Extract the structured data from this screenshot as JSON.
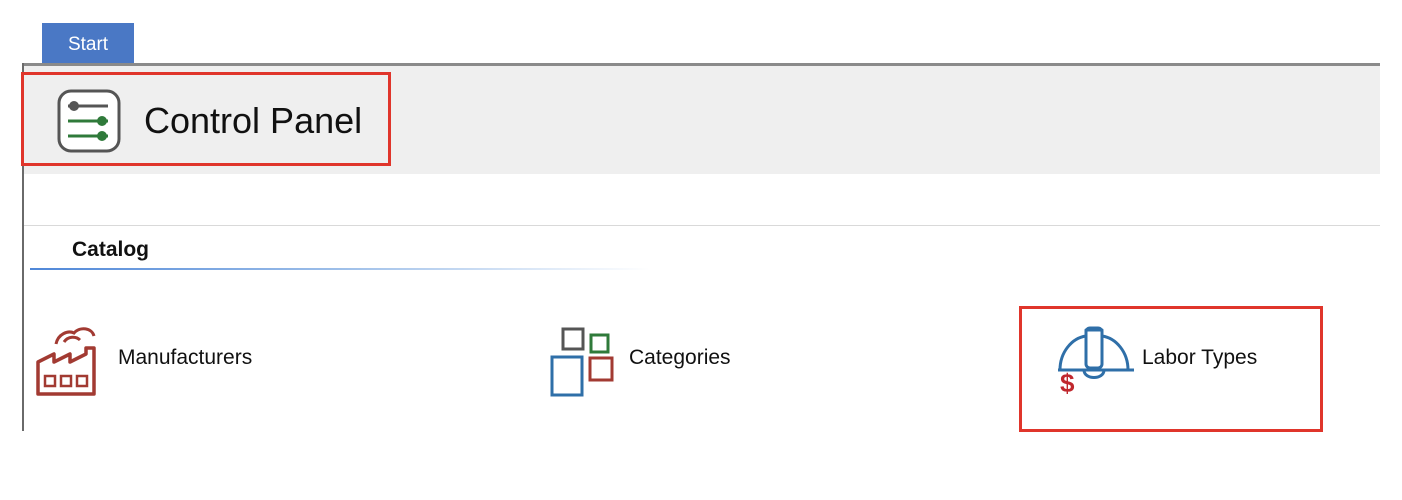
{
  "tabs": [
    {
      "label": "Start"
    }
  ],
  "header": {
    "title": "Control Panel",
    "icon": "control-panel-icon"
  },
  "catalog": {
    "title": "Catalog",
    "items": [
      {
        "label": "Manufacturers",
        "icon": "factory-icon"
      },
      {
        "label": "Categories",
        "icon": "categories-icon"
      },
      {
        "label": "Labor Types",
        "icon": "hard-hat-dollar-icon"
      }
    ]
  },
  "colors": {
    "tab_background": "#4a78c5",
    "highlight_box": "#e0352b",
    "header_background": "#efefef",
    "factory_icon": "#a23a32",
    "icon_green": "#2f7a3a",
    "icon_blue": "#2f6fa8"
  }
}
